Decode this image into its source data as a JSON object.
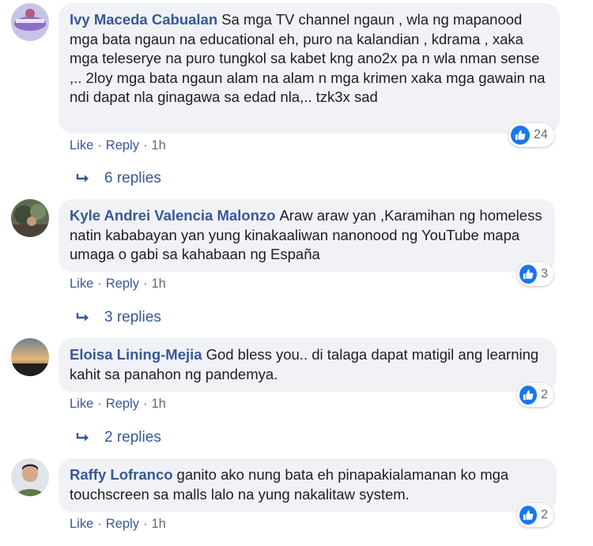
{
  "comments": [
    {
      "author": "Ivy Maceda Cabualan",
      "text": "Sa mga TV channel ngaun , wla ng mapanood mga bata ngaun na educational eh, puro na kalandian , kdrama , xaka mga teleserye na puro tungkol sa kabet kng ano2x pa n wla nman sense ,.. 2loy mga bata ngaun alam na alam n mga krimen xaka mga gawain na ndi dapat nla ginagawa sa edad nla,.. tzk3x sad",
      "like_label": "Like",
      "reply_label": "Reply",
      "time": "1h",
      "reaction_count": "24",
      "replies_label": "6 replies"
    },
    {
      "author": "Kyle Andrei Valencia Malonzo",
      "text": "Araw araw yan ,Karamihan ng homeless natin kababayan yan yung kinakaaliwan nanonood ng YouTube mapa umaga o gabi sa kahabaan ng España",
      "like_label": "Like",
      "reply_label": "Reply",
      "time": "1h",
      "reaction_count": "3",
      "replies_label": "3 replies"
    },
    {
      "author": "Eloisa Lining-Mejia",
      "text": "God bless you.. di talaga dapat matigil ang learning kahit sa panahon ng pandemya.",
      "like_label": "Like",
      "reply_label": "Reply",
      "time": "1h",
      "reaction_count": "2",
      "replies_label": "2 replies"
    },
    {
      "author": "Raffy Lofranco",
      "text": "ganito ako nung bata eh pinapakialamanan ko mga touchscreen sa malls lalo na yung nakalitaw system.",
      "like_label": "Like",
      "reply_label": "Reply",
      "time": "1h",
      "reaction_count": "2"
    }
  ],
  "separator": "·",
  "icons": {
    "reaction": "like-icon",
    "replies": "reply-arrow-icon"
  },
  "colors": {
    "link": "#385898",
    "bubble": "#f0f2f5",
    "like": "#1877f2",
    "meta": "#65676b"
  }
}
